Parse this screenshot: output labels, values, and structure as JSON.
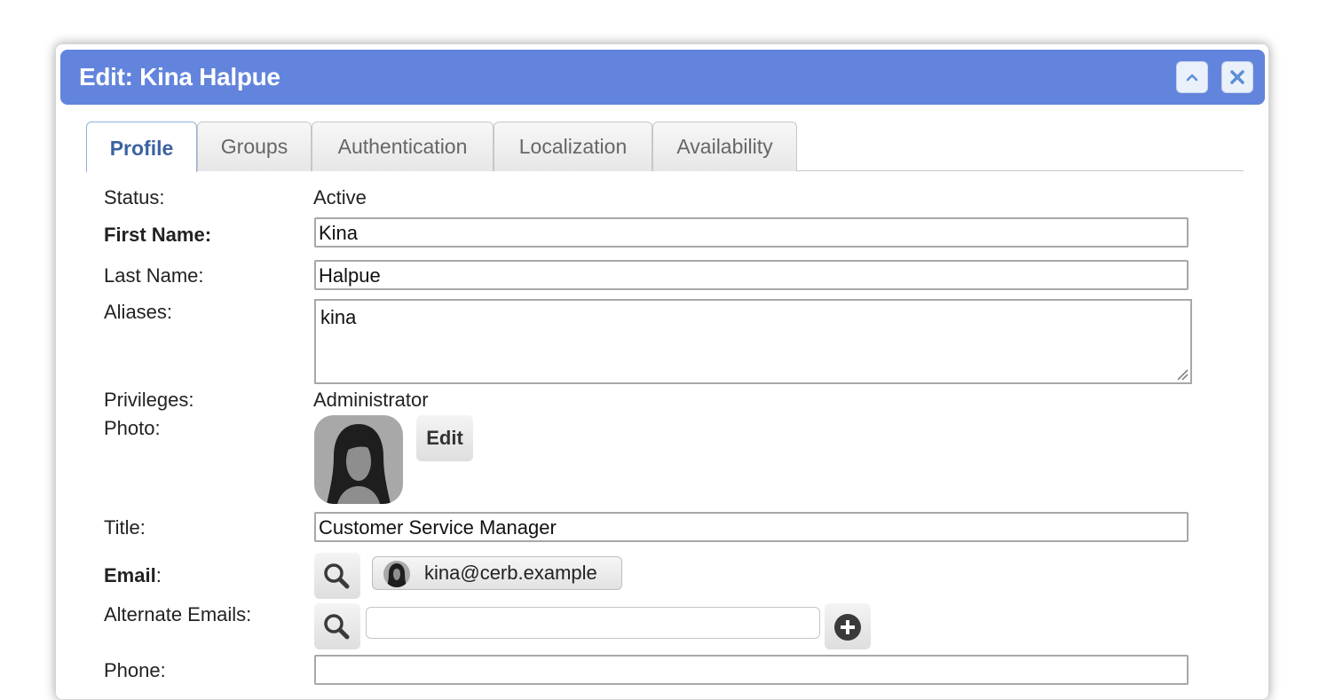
{
  "dialog": {
    "title": "Edit: Kina Halpue"
  },
  "tabs": [
    {
      "label": "Profile"
    },
    {
      "label": "Groups"
    },
    {
      "label": "Authentication"
    },
    {
      "label": "Localization"
    },
    {
      "label": "Availability"
    }
  ],
  "active_tab": "Profile",
  "form": {
    "status": {
      "label": "Status:",
      "value": "Active"
    },
    "first_name": {
      "label": "First Name:",
      "value": "Kina"
    },
    "last_name": {
      "label": "Last Name:",
      "value": "Halpue"
    },
    "aliases": {
      "label": "Aliases:",
      "value": "kina"
    },
    "privileges": {
      "label": "Privileges:",
      "value": "Administrator"
    },
    "photo": {
      "label": "Photo:",
      "edit_label": "Edit"
    },
    "title": {
      "label": "Title:",
      "value": "Customer Service Manager"
    },
    "email": {
      "label_bold": "Email",
      "label_suffix": ":",
      "value": "kina@cerb.example"
    },
    "alternate_emails": {
      "label": "Alternate Emails:",
      "value": ""
    },
    "phone": {
      "label": "Phone:",
      "value": ""
    }
  },
  "colors": {
    "titlebar": "#6284dc",
    "active_tab_text": "#3a63a0"
  },
  "icons": {
    "collapse": "chevron-up-icon",
    "close": "close-icon",
    "search": "search-icon",
    "add": "plus-circle-icon"
  }
}
